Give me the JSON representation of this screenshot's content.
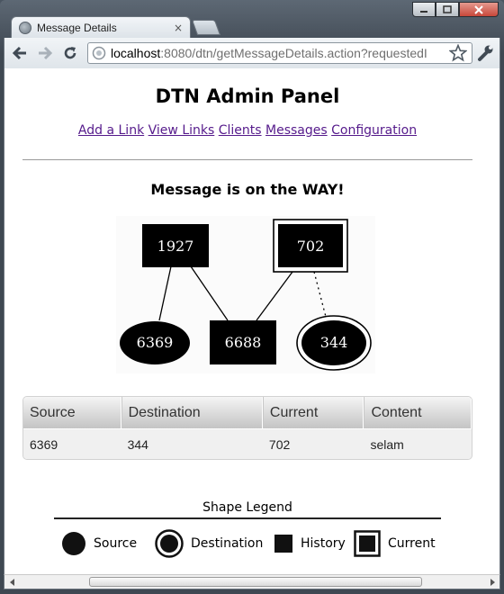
{
  "browser": {
    "tab_title": "Message Details",
    "tab_close": "×",
    "url_host": "localhost",
    "url_rest": ":8080/dtn/getMessageDetails.action?requestedI"
  },
  "page": {
    "title": "DTN Admin Panel",
    "nav": [
      "Add a Link",
      "View Links",
      "Clients",
      "Messages",
      "Configuration"
    ],
    "status": "Message is on the WAY!"
  },
  "graph": {
    "nodes": {
      "n1927": "1927",
      "n702": "702",
      "n6369": "6369",
      "n6688": "6688",
      "n344": "344"
    }
  },
  "table": {
    "headers": [
      "Source",
      "Destination",
      "Current",
      "Content"
    ],
    "rows": [
      [
        "6369",
        "344",
        "702",
        "selam"
      ]
    ]
  },
  "legend": {
    "title": "Shape Legend",
    "items": [
      "Source",
      "Destination",
      "History",
      "Current"
    ]
  }
}
